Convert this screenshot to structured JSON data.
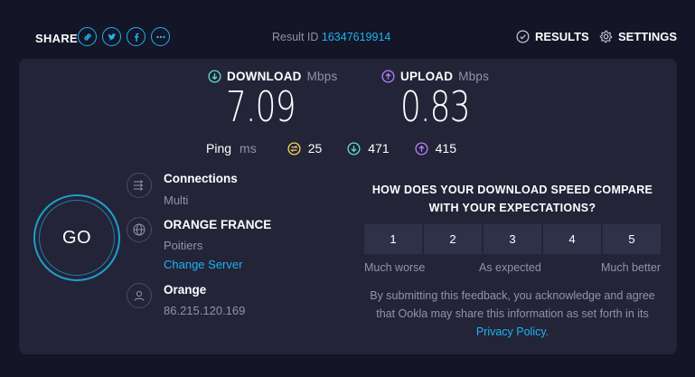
{
  "topbar": {
    "share_label": "SHARE",
    "share_icons": [
      "link-icon",
      "twitter-icon",
      "facebook-icon",
      "more-icon"
    ],
    "result_id_label": "Result ID",
    "result_id_value": "16347619914",
    "results_label": "RESULTS",
    "settings_label": "SETTINGS"
  },
  "download": {
    "label": "DOWNLOAD",
    "unit": "Mbps",
    "value": "7.09"
  },
  "upload": {
    "label": "UPLOAD",
    "unit": "Mbps",
    "value": "0.83"
  },
  "ping": {
    "label": "Ping",
    "unit": "ms",
    "idle": "25",
    "download": "471",
    "upload": "415"
  },
  "go_label": "GO",
  "connections": {
    "title": "Connections",
    "value": "Multi"
  },
  "server": {
    "title": "ORANGE FRANCE",
    "location": "Poitiers",
    "change_label": "Change Server"
  },
  "isp": {
    "title": "Orange",
    "ip": "86.215.120.169"
  },
  "feedback": {
    "question": "HOW DOES YOUR DOWNLOAD SPEED COMPARE WITH YOUR EXPECTATIONS?",
    "ratings": [
      "1",
      "2",
      "3",
      "4",
      "5"
    ],
    "low_label": "Much worse",
    "mid_label": "As expected",
    "high_label": "Much better",
    "disclaimer_text": "By submitting this feedback, you acknowledge and agree that Ookla may share this information as set forth in its",
    "privacy_label": "Privacy Policy",
    "period": "."
  },
  "colors": {
    "accent": "#1cb4f0",
    "download": "#5de0c6",
    "upload": "#b77ff5",
    "ping_idle": "#f5d35f",
    "background": "#141526",
    "panel": "#232438"
  }
}
